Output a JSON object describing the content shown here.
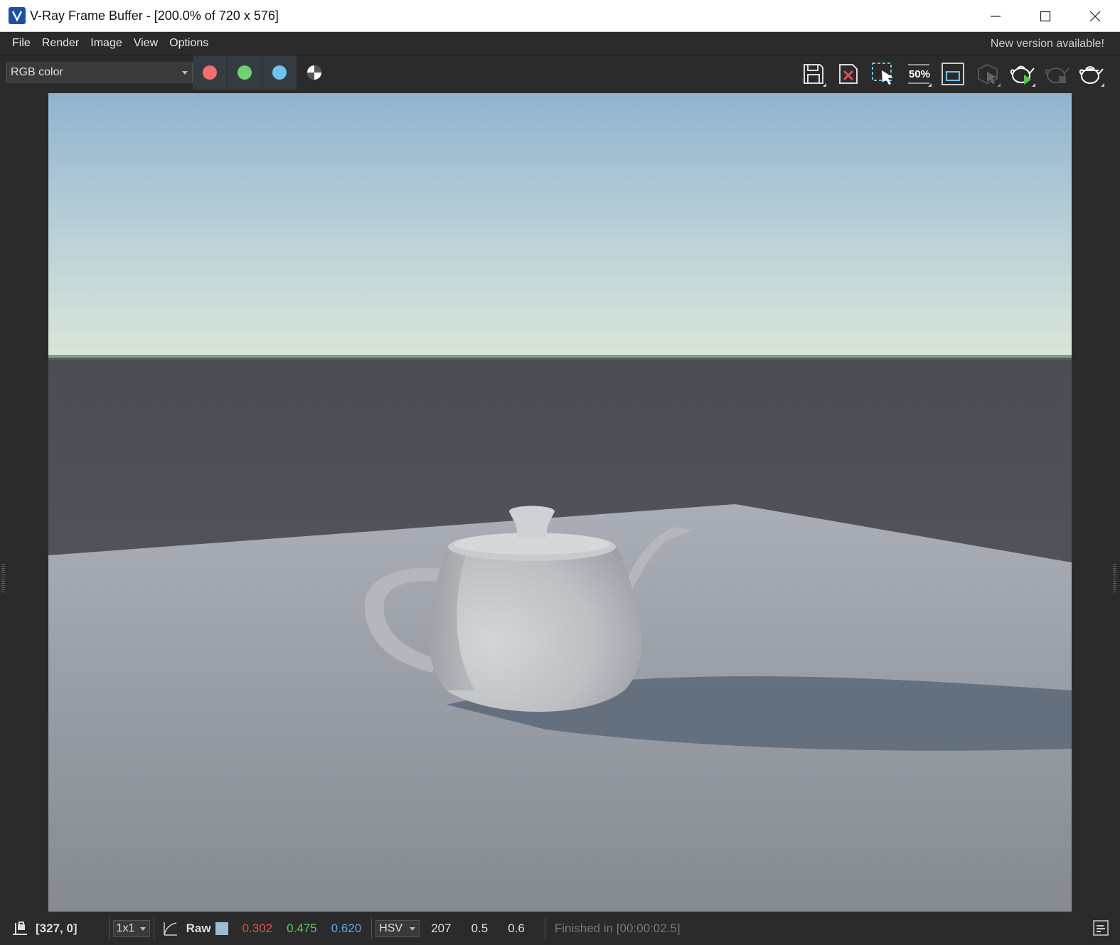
{
  "window": {
    "title": "V-Ray Frame Buffer - [200.0% of 720 x 576]"
  },
  "menu": {
    "items": [
      "File",
      "Render",
      "Image",
      "View",
      "Options"
    ],
    "notice": "New version available!"
  },
  "toolbar": {
    "channel": "RGB color",
    "channel_colors": {
      "red": "#f07070",
      "green": "#6fd16f",
      "blue": "#6ec3f0"
    },
    "icons": [
      "save-icon",
      "clear-image-icon",
      "region-render-icon",
      "50-percent-icon",
      "track-mouse-icon",
      "render-interactive-icon",
      "start-render-icon",
      "stop-render-icon",
      "render-icon"
    ],
    "zoom_label": "50%"
  },
  "status": {
    "coords": "[327, 0]",
    "sample_size": "1x1",
    "mode": "Raw",
    "swatch_color": "#9bbcd6",
    "r": "0.302",
    "g": "0.475",
    "b": "0.620",
    "color_space": "HSV",
    "h": "207",
    "s": "0.5",
    "v": "0.6",
    "message": "Finished in [00:00:02.5]"
  }
}
